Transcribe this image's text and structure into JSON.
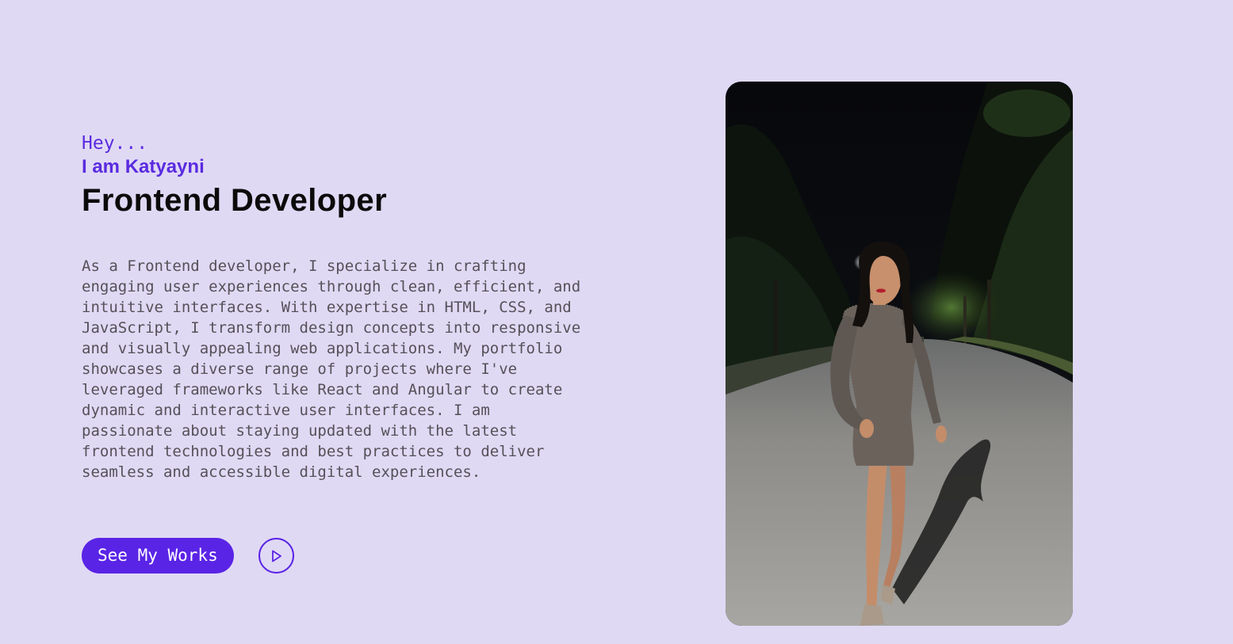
{
  "hero": {
    "greeting": "Hey...",
    "intro": "I am Katyayni",
    "role": "Frontend Developer",
    "bio": "As a Frontend developer, I specialize in crafting engaging user experiences through clean, efficient, and intuitive interfaces. With expertise in HTML, CSS, and JavaScript, I transform design concepts into responsive and visually appealing web applications. My portfolio showcases a diverse range of projects where I've leveraged frameworks like React and Angular to create dynamic and interactive user interfaces. I am passionate about staying updated with the latest frontend technologies and best practices to deliver seamless and accessible digital experiences."
  },
  "actions": {
    "works_label": "See My Works",
    "play_icon": "play-circle-icon"
  },
  "colors": {
    "background": "#e0d9f4",
    "accent": "#5a24e6",
    "heading": "#0b0b0b",
    "body_text": "#555058"
  }
}
